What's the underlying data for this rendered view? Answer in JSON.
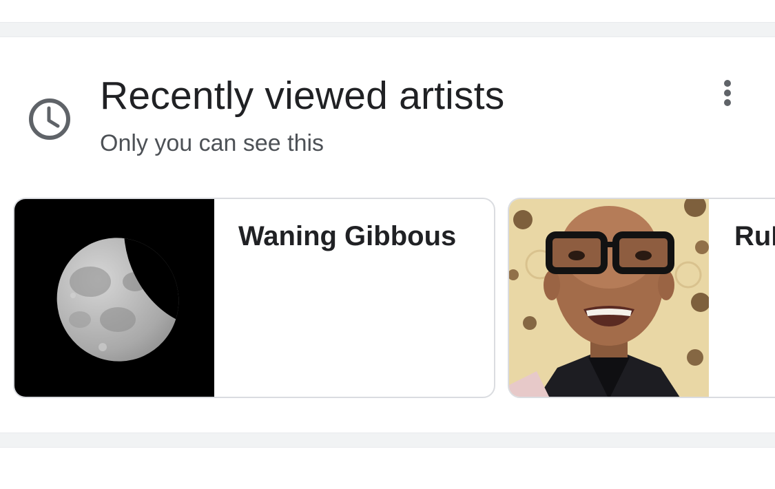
{
  "section": {
    "title": "Recently viewed artists",
    "subtitle": "Only you can see this",
    "header_icon": "clock-icon",
    "menu_icon": "more-vert-icon"
  },
  "artists": [
    {
      "name": "Waning Gibbous",
      "image": "moon-photo"
    },
    {
      "name": "RuPaul",
      "image": "portrait-photo"
    }
  ],
  "colors": {
    "separator": "#f1f3f4",
    "card_border": "#dadce0",
    "title_text": "#202124",
    "subtitle_text": "#4d5156",
    "icon": "#5f6368"
  }
}
